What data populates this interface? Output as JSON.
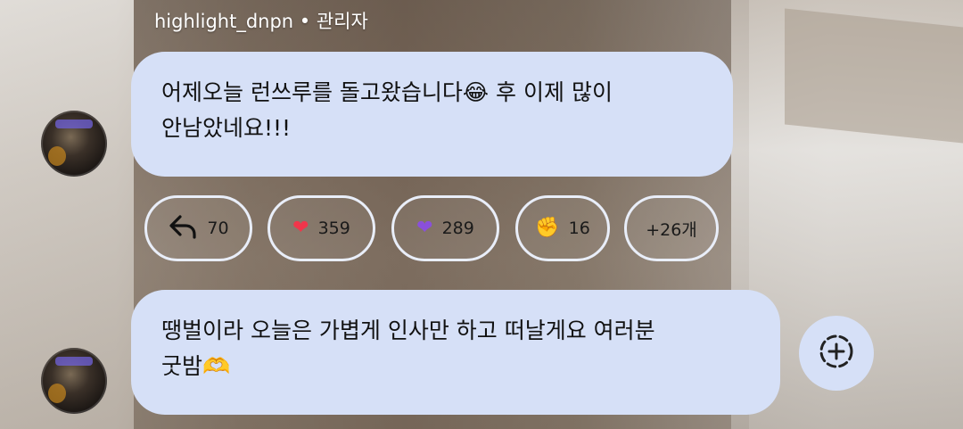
{
  "header": {
    "username": "highlight_dnpn • 관리자"
  },
  "messages": [
    {
      "text_line1": "어제오늘 런쓰루를 돌고왔습니다😂 후 이제 많이",
      "text_line2": "안남았네요!!!"
    },
    {
      "text_line1": "땡벌이라 오늘은 가볍게 인사만 하고 떠날게요 여러분",
      "text_line2": "굿밤🫶"
    }
  ],
  "reactions": [
    {
      "icon": "reply-icon",
      "count": "70"
    },
    {
      "icon": "red-heart-icon",
      "glyph": "❤",
      "count": "359"
    },
    {
      "icon": "purple-heart-icon",
      "glyph": "❤",
      "count": "289"
    },
    {
      "icon": "fist-icon",
      "glyph": "✊",
      "count": "16"
    },
    {
      "icon": "more",
      "label": "+26개"
    }
  ],
  "colors": {
    "bubble": "#d6e0f7",
    "chip_border": "#e9eef9",
    "red_heart": "#f0364b",
    "purple_heart": "#8a4fdc"
  }
}
